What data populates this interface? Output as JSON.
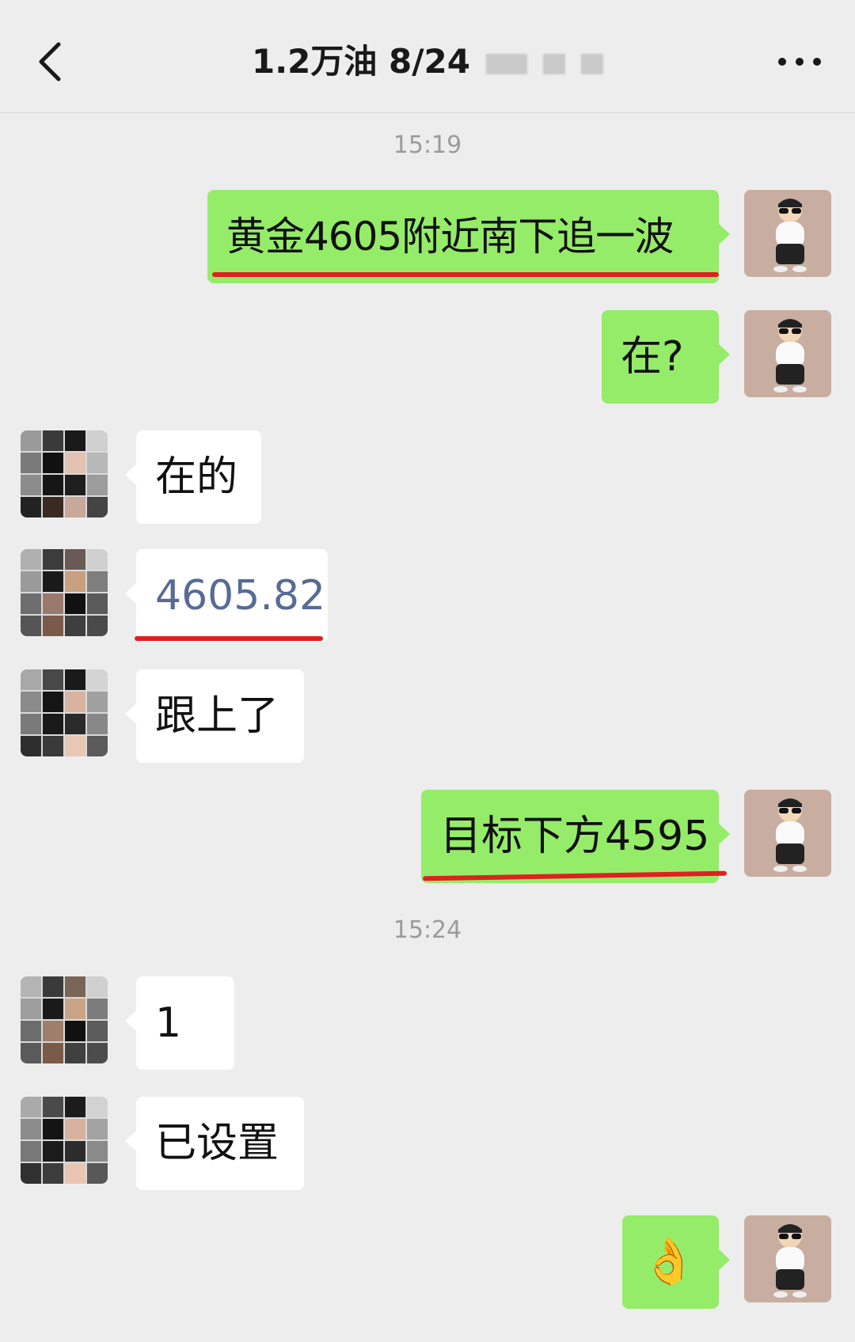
{
  "header": {
    "title": "1.2万油  8/24"
  },
  "colors": {
    "background": "#ededed",
    "my_bubble": "#95ec69",
    "other_bubble": "#ffffff",
    "highlight_underline": "#e02020",
    "link_number": "#576b95"
  },
  "timestamps": [
    "15:19",
    "15:24"
  ],
  "messages": [
    {
      "sender": "me",
      "text": "黄金4605附近南下追一波",
      "underlined": true
    },
    {
      "sender": "me",
      "text": "在?"
    },
    {
      "sender": "other",
      "text": "在的"
    },
    {
      "sender": "other",
      "text": "4605.82",
      "underlined": true
    },
    {
      "sender": "other",
      "text": "跟上了"
    },
    {
      "sender": "me",
      "text": "目标下方4595",
      "underlined": true
    },
    {
      "sender": "other",
      "text": "1"
    },
    {
      "sender": "other",
      "text": "已设置"
    },
    {
      "sender": "me",
      "text": "👌",
      "emoji": true
    }
  ]
}
